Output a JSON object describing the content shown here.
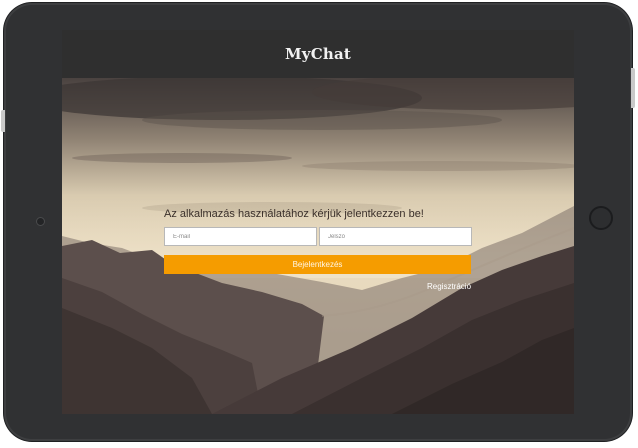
{
  "app": {
    "title": "MyChat"
  },
  "login": {
    "prompt": "Az alkalmazás használatához kérjük jelentkezzen be!",
    "email_placeholder": "E-mail",
    "password_placeholder": "Jelszó",
    "login_label": "Bejelentkezés",
    "register_label": "Regisztráció"
  },
  "colors": {
    "accent": "#f59c00",
    "appbar": "#2f2f2f",
    "device_frame": "#303133"
  },
  "icons": [
    "camera-icon",
    "home-button-icon"
  ]
}
